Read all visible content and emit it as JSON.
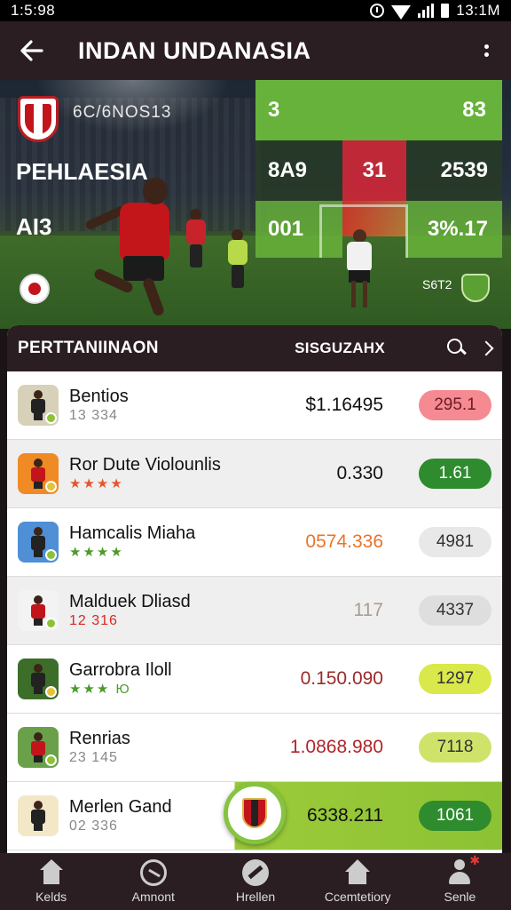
{
  "status_bar": {
    "time_left": "1:5:98",
    "time_right": "13:1M"
  },
  "app_bar": {
    "title": "INDAN UNDANASIA"
  },
  "hero": {
    "code": "6C/6NOS13",
    "name": "PEHLAESIA",
    "short": "AI3",
    "caption": "S6T2",
    "stats": [
      {
        "value": "3"
      },
      {
        "value": "83"
      },
      {
        "value": "8A9"
      },
      {
        "value": "31"
      },
      {
        "value": "2539"
      },
      {
        "value": "001"
      },
      {
        "value": "3%.17"
      }
    ]
  },
  "list": {
    "title": "PERTTANIINAON",
    "subtitle": "SISGUZAHX",
    "rows": [
      {
        "name": "Bentios",
        "sub": "13 334",
        "value": "$1.16495",
        "pill": "295.1",
        "pill_bg": "#f58a92",
        "pill_fg": "#6b1b22",
        "value_color": "#111",
        "avatar_bg": "#d6d1b8",
        "dot": "#8cc234"
      },
      {
        "name": "Ror Dute Violounlis",
        "sub": "★★★★",
        "value": "0.330",
        "pill": "1.61",
        "pill_bg": "#2e8b2e",
        "pill_fg": "#ffffff",
        "value_color": "#111",
        "avatar_bg": "#f08a24",
        "dot": "#e6c23a"
      },
      {
        "name": "Hamcalis Miaha",
        "sub": "★★★★",
        "value": "0574.336",
        "pill": "4981",
        "pill_bg": "#e8e8e8",
        "pill_fg": "#333",
        "value_color": "#e8732a",
        "avatar_bg": "#4f8fd6",
        "dot": "#8cc234"
      },
      {
        "name": "Malduek Dliasd",
        "sub": "12 316",
        "value": "117",
        "pill": "4337",
        "pill_bg": "#dedede",
        "pill_fg": "#333",
        "value_color": "#a89e92",
        "avatar_bg": "#f3f3f3",
        "dot": "#8cc234"
      },
      {
        "name": "Garrobra Iloll",
        "sub": "★★★ Ю",
        "value": "0.150.090",
        "pill": "1297",
        "pill_bg": "#d9e84a",
        "pill_fg": "#333",
        "value_color": "#9a2a2a",
        "avatar_bg": "#3c6e2a",
        "dot": "#e6c23a"
      },
      {
        "name": "Renrias",
        "sub": "23 145",
        "value": "1.0868.980",
        "pill": "7118",
        "pill_bg": "#cfe36a",
        "pill_fg": "#333",
        "value_color": "#b0242a",
        "avatar_bg": "#6aa04a",
        "dot": "#8cc234"
      },
      {
        "name": "Merlen Gand",
        "sub": "02 336",
        "value": "6338.211",
        "pill": "1061",
        "pill_bg": "#2e8b2e",
        "pill_fg": "#ffffff",
        "value_color": "#111",
        "avatar_bg": "#f2e8c8",
        "dot": ""
      }
    ]
  },
  "bottom_nav": {
    "items": [
      {
        "label": "Kelds",
        "icon": "home-icon"
      },
      {
        "label": "Amnont",
        "icon": "ball-icon"
      },
      {
        "label": "Hrellen",
        "icon": "boot-icon"
      },
      {
        "label": "Ccemtetiory",
        "icon": "community-icon"
      },
      {
        "label": "Senle",
        "icon": "user-icon"
      }
    ]
  },
  "colors": {
    "accent_green": "#8cc234",
    "brand_dark": "#2a1e22",
    "brand_red": "#c1151b"
  }
}
